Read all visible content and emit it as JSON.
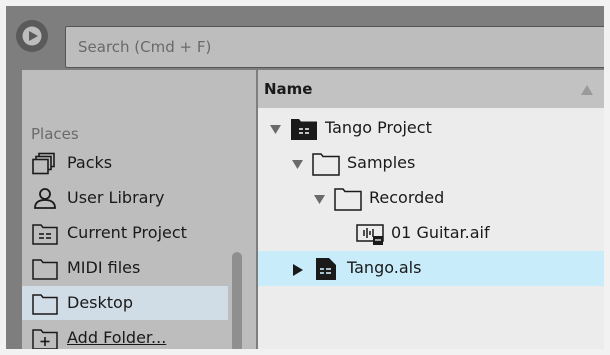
{
  "search": {
    "placeholder": "Search (Cmd + F)"
  },
  "places": {
    "heading": "Places",
    "items": [
      {
        "label": "Packs",
        "icon": "packs-icon"
      },
      {
        "label": "User Library",
        "icon": "user-icon"
      },
      {
        "label": "Current Project",
        "icon": "project-folder-icon"
      },
      {
        "label": "MIDI files",
        "icon": "folder-icon"
      },
      {
        "label": "Desktop",
        "icon": "folder-icon",
        "selected": true
      },
      {
        "label": "Add Folder...",
        "icon": "add-folder-icon"
      }
    ]
  },
  "browser": {
    "column_header": "Name",
    "rows": [
      {
        "label": "Tango Project",
        "icon": "project-folder-icon",
        "expanded": true
      },
      {
        "label": "Samples",
        "icon": "folder-icon",
        "expanded": true
      },
      {
        "label": "Recorded",
        "icon": "folder-icon",
        "expanded": true
      },
      {
        "label": "01 Guitar.aif",
        "icon": "audio-file-icon"
      },
      {
        "label": "Tango.als",
        "icon": "live-set-icon",
        "expanded": false,
        "selected": true
      }
    ]
  },
  "colors": {
    "selection_left": "#d1dde6",
    "selection_right": "#c9ecfb",
    "panel": "#bdbdbd"
  }
}
